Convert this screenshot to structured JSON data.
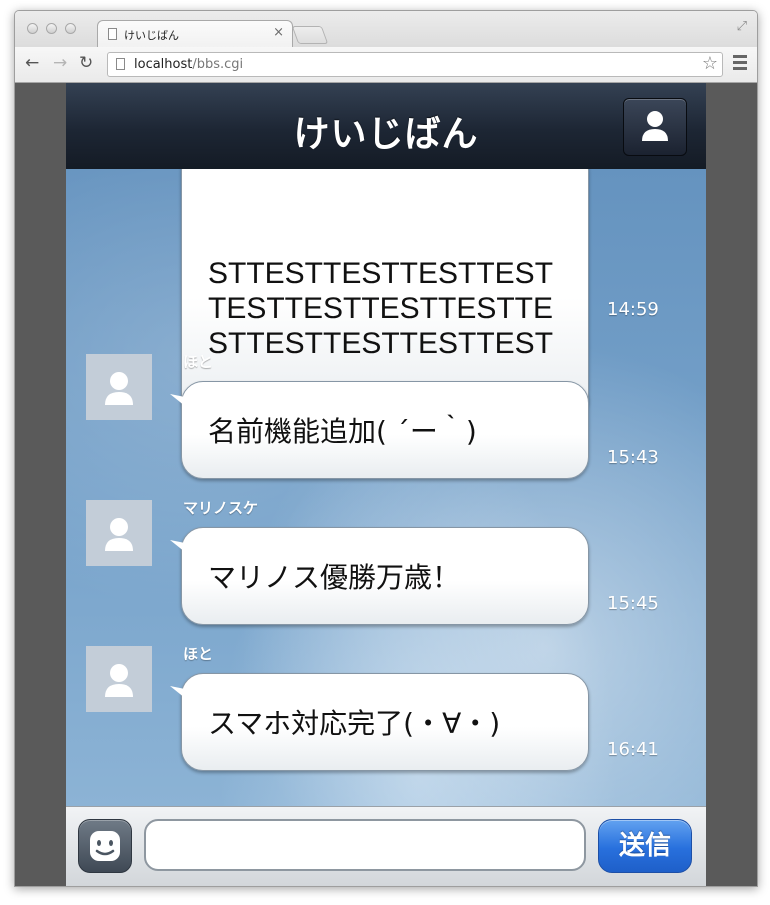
{
  "browser": {
    "tab_title": "けいじばん",
    "tab_close": "×",
    "url_host": "localhost",
    "url_path": "/bbs.cgi",
    "back": "←",
    "forward": "→",
    "reload": "↻",
    "bookmark_star": "☆",
    "resize": "⤢"
  },
  "app": {
    "title": "けいじばん"
  },
  "messages": [
    {
      "sender": "",
      "text": "STTESTTESTTESTTEST\nTESTTESTTESTTESTTE\nSTTESTTESTTESTTEST",
      "time": "14:59"
    },
    {
      "sender": "ほと",
      "text": "名前機能追加( ´ー｀)",
      "time": "15:43"
    },
    {
      "sender": "マリノスケ",
      "text": "マリノス優勝万歳！",
      "time": "15:45"
    },
    {
      "sender": "ほと",
      "text": "スマホ対応完了(・∀・)",
      "time": "16:41"
    }
  ],
  "composer": {
    "input_value": "",
    "send_label": "送信"
  }
}
